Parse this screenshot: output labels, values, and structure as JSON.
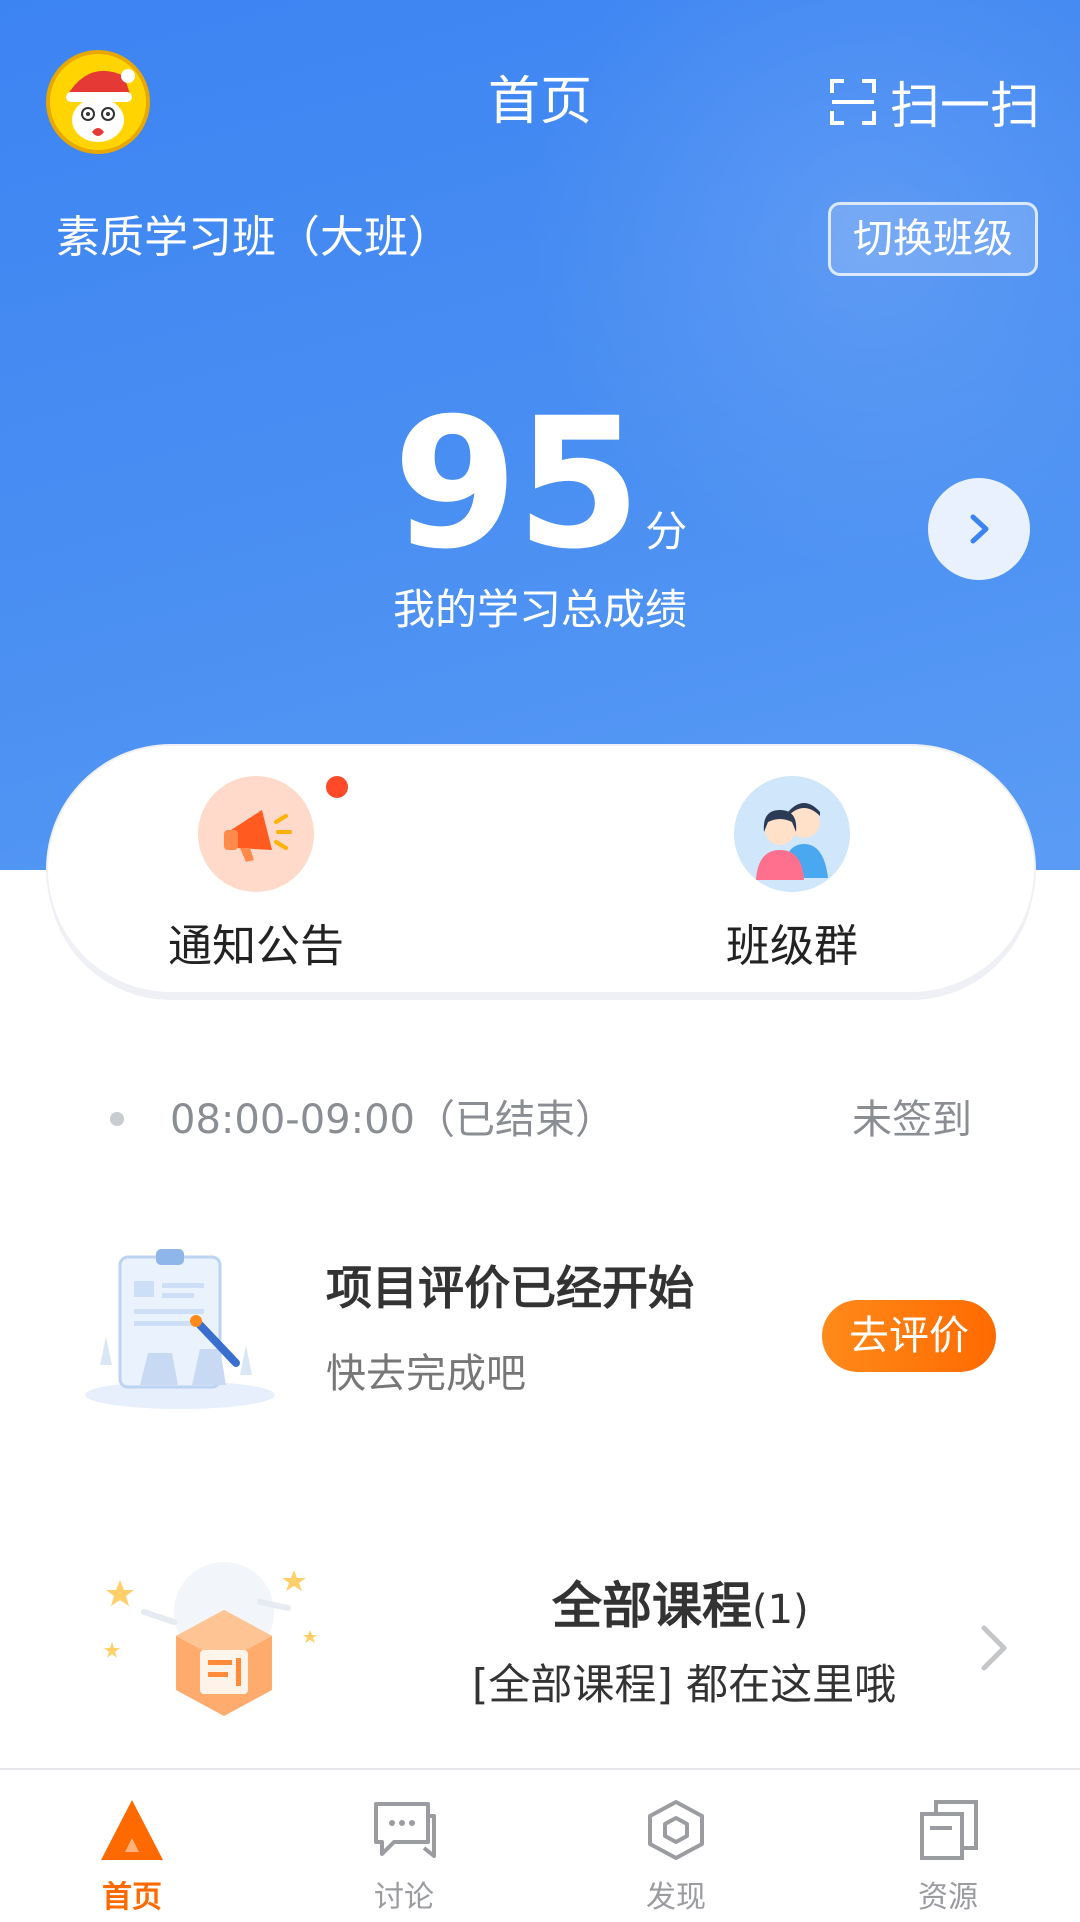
{
  "header": {
    "title": "首页",
    "scan_label": "扫一扫",
    "class_name": "素质学习班（大班）",
    "switch_label": "切换班级"
  },
  "score": {
    "value": "95",
    "unit": "分",
    "label": "我的学习总成绩"
  },
  "quick_actions": [
    {
      "label": "通知公告",
      "icon": "megaphone-icon",
      "has_badge": true
    },
    {
      "label": "班级群",
      "icon": "group-chat-icon",
      "has_badge": false
    }
  ],
  "attendance": {
    "time": "08:00-09:00（已结束）",
    "status": "未签到"
  },
  "evaluation": {
    "title": "项目评价已经开始",
    "subtitle": "快去完成吧",
    "button": "去评价"
  },
  "courses": {
    "title": "全部课程",
    "count": "(1)",
    "subtitle": "[全部课程] 都在这里哦"
  },
  "tabs": [
    {
      "label": "首页",
      "icon": "home-triangle-icon",
      "active": true
    },
    {
      "label": "讨论",
      "icon": "discussion-icon",
      "active": false
    },
    {
      "label": "发现",
      "icon": "discover-icon",
      "active": false
    },
    {
      "label": "资源",
      "icon": "resources-icon",
      "active": false
    }
  ],
  "colors": {
    "primary": "#3d84f3",
    "accent": "#ff6a00",
    "badge": "#ff4a2a"
  }
}
